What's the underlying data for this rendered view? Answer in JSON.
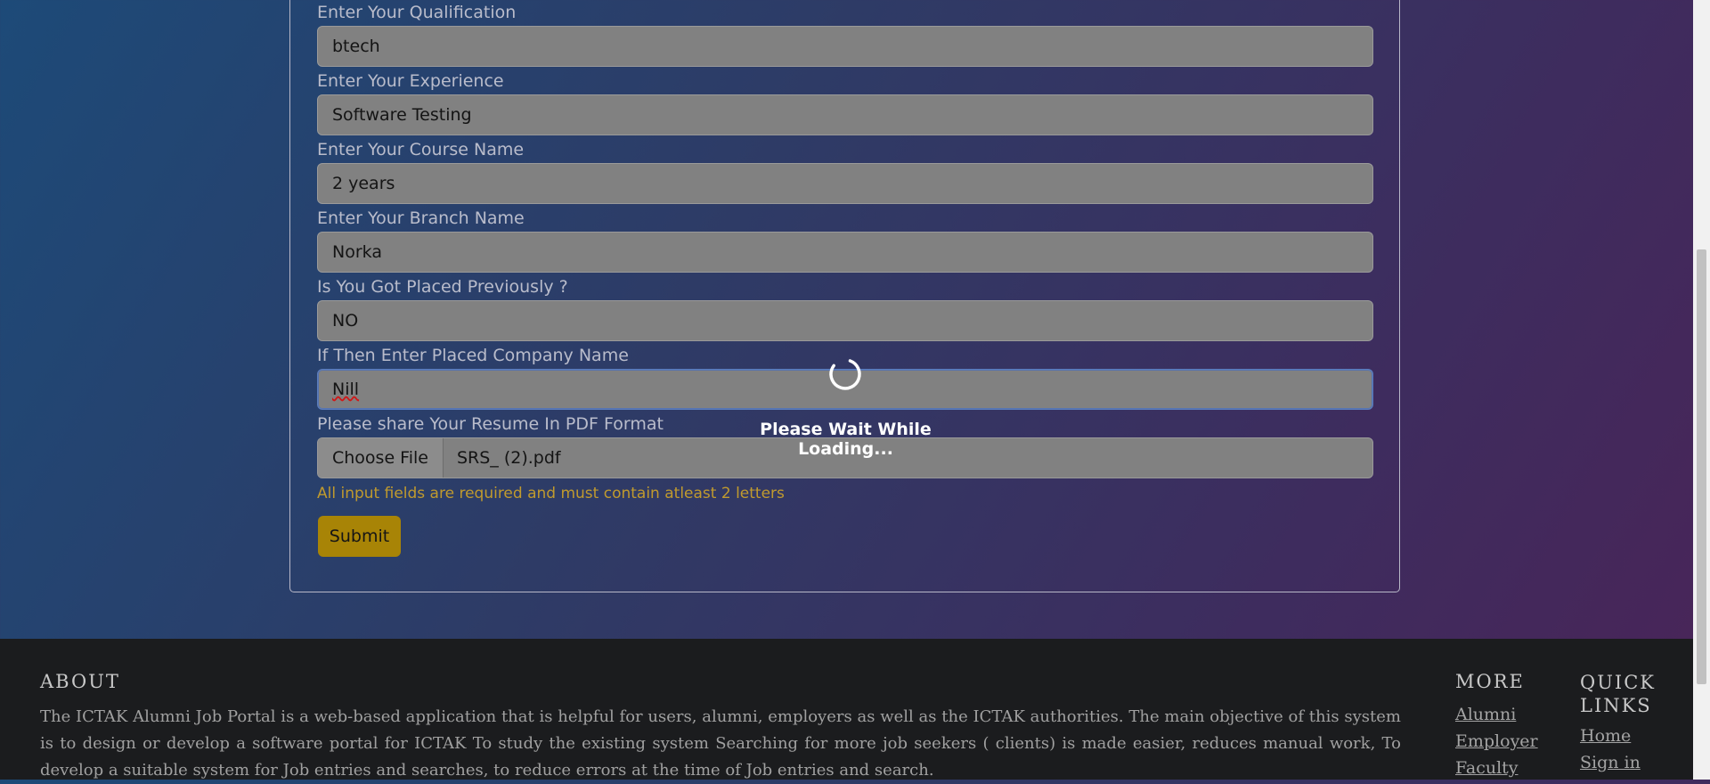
{
  "form": {
    "fields": [
      {
        "label": "Enter Your Qualification",
        "value": "btech"
      },
      {
        "label": "Enter Your Experience",
        "value": "Software Testing"
      },
      {
        "label": "Enter Your Course Name",
        "value": "2 years"
      },
      {
        "label": "Enter Your Branch Name",
        "value": "Norka"
      },
      {
        "label": "Is You Got Placed Previously ?",
        "value": "NO"
      },
      {
        "label": "If Then Enter Placed Company Name",
        "value": "Nill"
      }
    ],
    "resume": {
      "label": "Please share Your Resume In PDF Format",
      "button_label": "Choose File",
      "file_name": "SRS_ (2).pdf"
    },
    "hint": "All input fields are required and must contain atleast 2 letters",
    "submit_label": "Submit"
  },
  "loading": {
    "text": "Please Wait While Loading...",
    "icon": "spinner-icon"
  },
  "footer": {
    "about_heading": "ABOUT",
    "about_text": "The ICTAK Alumni Job Portal is a web-based application that is helpful for users, alumni, employers as well as the ICTAK authorities. The main objective of this system is to design or develop a software portal for ICTAK To study the existing system Searching for more job seekers ( clients) is made easier, reduces manual work, To develop a suitable system for Job entries and searches, to reduce errors at the time of Job entries and search.",
    "more_heading": "MORE",
    "more_links": [
      "Alumni",
      "Employer",
      "Faculty"
    ],
    "quick_heading": "QUICK LINKS",
    "quick_links": [
      "Home",
      "Sign in"
    ]
  },
  "colors": {
    "accent": "#a88406",
    "hint": "#c09a2e",
    "footer_bg": "#1b1c1e"
  }
}
